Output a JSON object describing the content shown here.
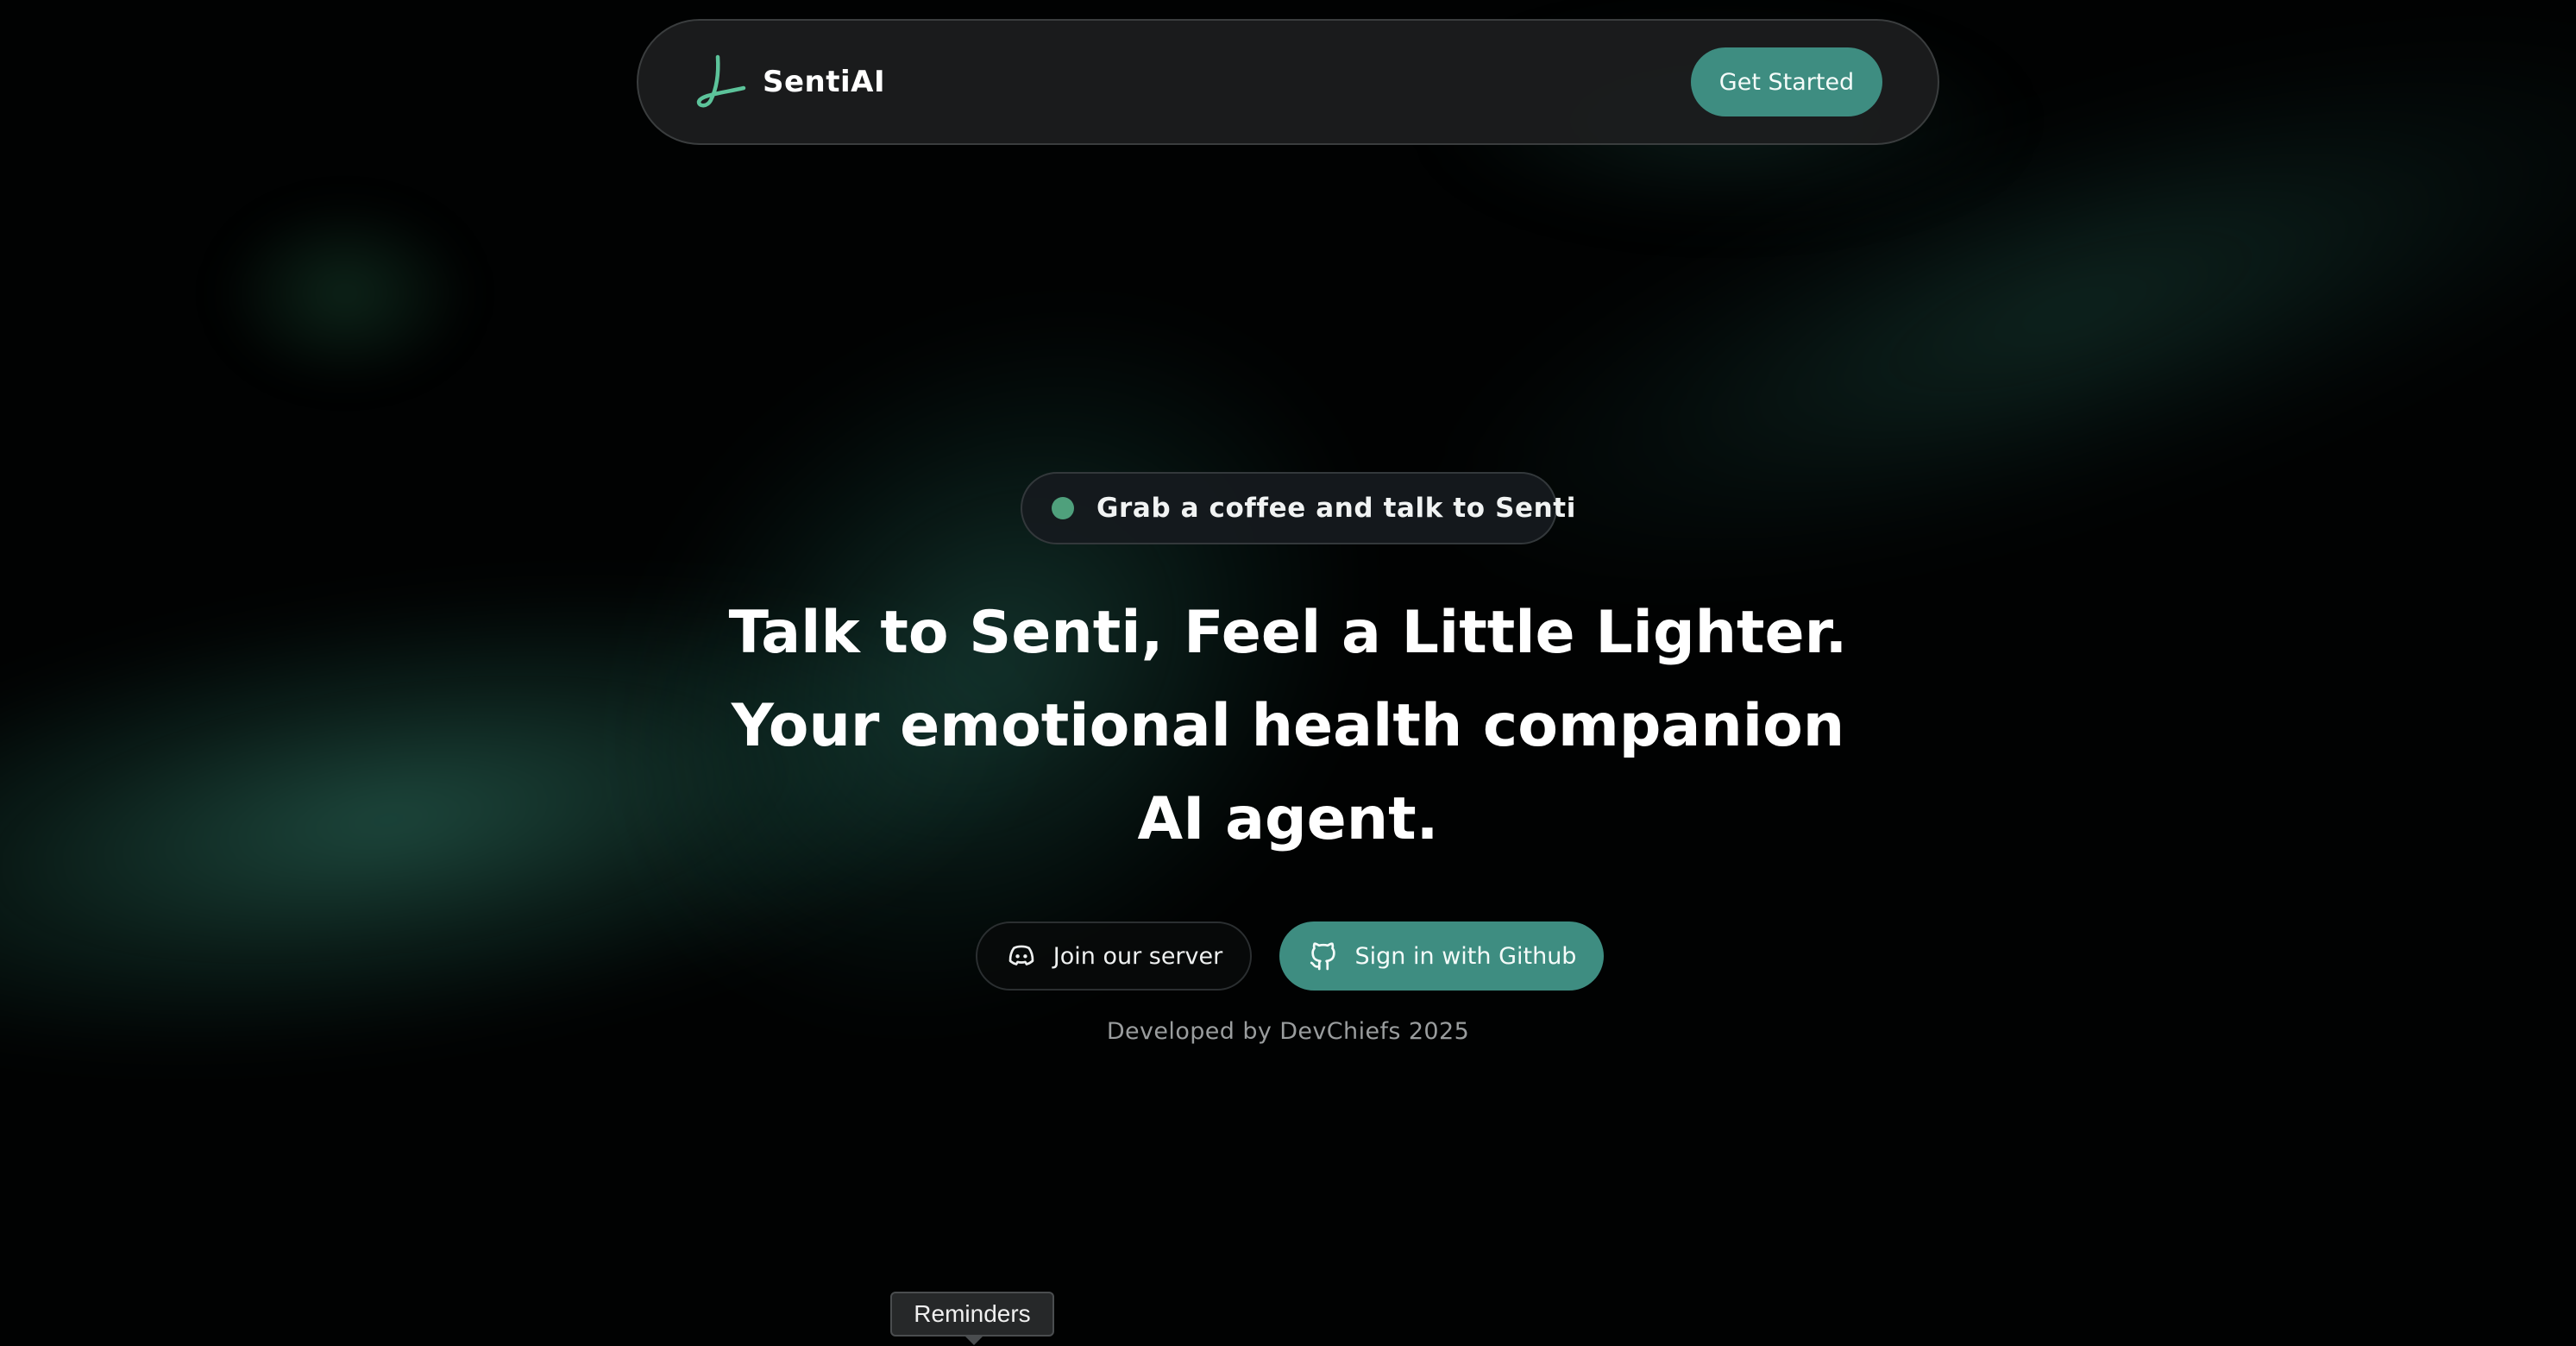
{
  "brand": {
    "name": "SentiAI",
    "logo_icon": "senti-logo-icon",
    "accent_color": "#3e8d81"
  },
  "nav": {
    "cta_label": "Get Started"
  },
  "badge": {
    "text": "Grab a coffee and talk to Senti",
    "dot_color": "#4fa07c"
  },
  "headline": {
    "line1": "Talk to Senti, Feel a Little Lighter.",
    "line2": "Your emotional health companion",
    "line3": "AI agent."
  },
  "actions": {
    "discord_label": "Join our server",
    "discord_icon": "discord-icon",
    "github_label": "Sign in with Github",
    "github_icon": "github-icon"
  },
  "footer": {
    "credit": "Developed by DevChiefs 2025"
  },
  "tooltip": {
    "text": "Reminders"
  }
}
